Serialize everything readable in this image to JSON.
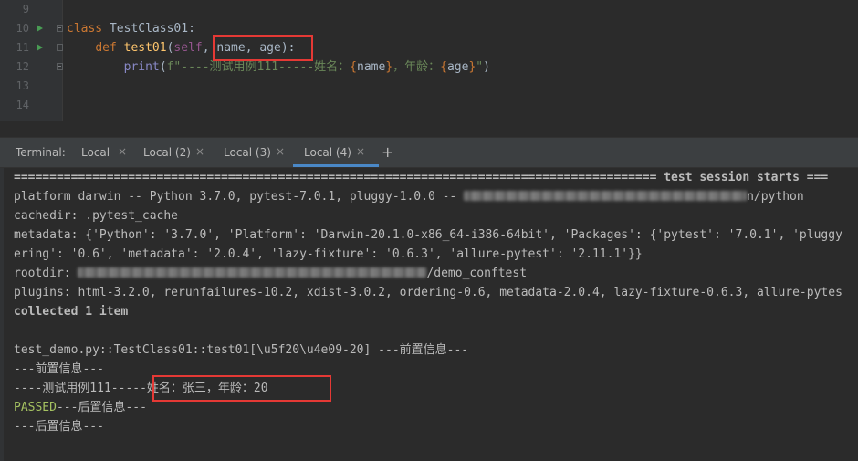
{
  "editor": {
    "line_numbers": [
      "9",
      "10",
      "11",
      "12",
      "13",
      "14"
    ],
    "code": {
      "line10": {
        "kw": "class",
        "name": " TestClass01",
        "colon": ":"
      },
      "line11": {
        "kw": "def",
        "fn": "test01",
        "open": "(",
        "self": "self",
        "comma1": ", ",
        "params": "name, age",
        "close": "):"
      },
      "line12": {
        "bi": "print",
        "open": "(",
        "str_prefix": "f\"----测试用例111-----姓名：",
        "b1o": "{",
        "v1": "name",
        "b1c": "}",
        "mid": "，年龄：",
        "b2o": "{",
        "v2": "age",
        "b2c": "}",
        "str_end": "\"",
        "close": ")"
      }
    }
  },
  "terminal_tabs": {
    "label": "Terminal:",
    "tabs": [
      {
        "label": "Local",
        "active": false
      },
      {
        "label": "Local (2)",
        "active": false
      },
      {
        "label": "Local (3)",
        "active": false
      },
      {
        "label": "Local (4)",
        "active": true
      }
    ],
    "add": "+",
    "close_glyph": "×"
  },
  "terminal": {
    "session_line": "========================================================================================== test session starts ===",
    "platform_prefix": "platform darwin -- Python 3.7.0, pytest-7.0.1, pluggy-1.0.0 -- ",
    "platform_suffix": "n/python",
    "cachedir": "cachedir: .pytest_cache",
    "metadata1": "metadata: {'Python': '3.7.0', 'Platform': 'Darwin-20.1.0-x86_64-i386-64bit', 'Packages': {'pytest': '7.0.1', 'pluggy",
    "metadata2": "ering': '0.6', 'metadata': '2.0.4', 'lazy-fixture': '0.6.3', 'allure-pytest': '2.11.1'}}",
    "rootdir_prefix": "rootdir: ",
    "rootdir_suffix": "/demo_conftest",
    "plugins": "plugins: html-3.2.0, rerunfailures-10.2, xdist-3.0.2, ordering-0.6, metadata-2.0.4, lazy-fixture-0.6.3, allure-pytes",
    "collected": "collected 1 item",
    "test_line": "test_demo.py::TestClass01::test01[\\u5f20\\u4e09-20] ---前置信息---",
    "pre_info": "---前置信息---",
    "case_prefix": "----测试用例111-----",
    "case_result": "姓名：张三，年龄：20",
    "passed": "PASSED",
    "post_info_inline": "---后置信息---",
    "post_info": "---后置信息---"
  }
}
